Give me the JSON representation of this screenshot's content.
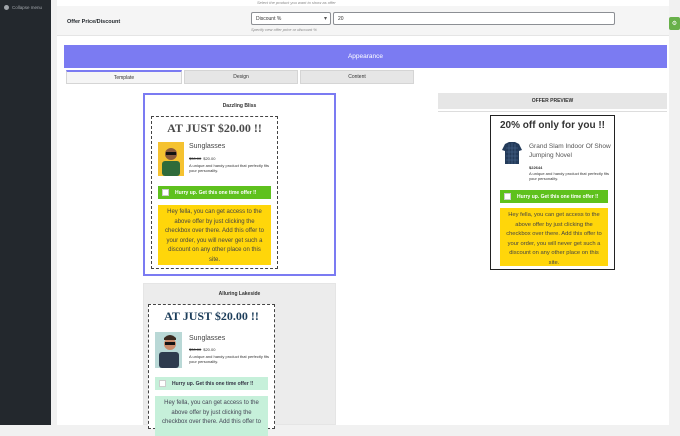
{
  "sidebar": {
    "collapse_label": "Collapse menu"
  },
  "offer_row": {
    "top_hint": "Select the product you want to show as offer",
    "label": "Offer Price/Discount",
    "type_value": "Discount %",
    "amount_value": "20",
    "hint": "Specify new offer price or discount %"
  },
  "appearance": {
    "title": "Appearance"
  },
  "tabs": [
    {
      "label": "Template"
    },
    {
      "label": "Design"
    },
    {
      "label": "Content"
    }
  ],
  "templates": [
    {
      "name": "Dazzling Bliss",
      "headline": "AT JUST $20.00 !!",
      "product": "Sunglasses",
      "old_price": "$30.00",
      "new_price": "$20.00",
      "description": "A unique and handy product that perfectly fits your personality.",
      "cta": "Hurry up. Get this one time offer !!",
      "message": "Hey fella, you can get access to the above offer by just clicking the checkbox over there. Add this offer to your order, you will never get such a discount on any other place on this site."
    },
    {
      "name": "Alluring Lakeside",
      "headline": "AT JUST $20.00 !!",
      "product": "Sunglasses",
      "old_price": "$30.00",
      "new_price": "$20.00",
      "description": "A unique and handy product that perfectly fits your personality.",
      "cta": "Hurry up. Get this one time offer !!",
      "message": "Hey fella, you can get access to the above offer by just clicking the checkbox over there. Add this offer to"
    }
  ],
  "preview": {
    "heading": "OFFER PREVIEW",
    "headline": "20% off only for you !!",
    "product": "Grand Slam Indoor Of Show Jumping Novel",
    "price": "$22644",
    "description": "A unique and handy product that perfectly fits your personality.",
    "cta": "Hurry up. Get this one time offer !!",
    "message": "Hey fella, you can get access to the above offer by just clicking the checkbox over there. Add this offer to your order, you will never get such a discount on any other place on this site."
  },
  "colors": {
    "accent": "#7b7bf2",
    "green": "#5fc11d",
    "yellow": "#ffd60a",
    "mint": "#c6f0da"
  }
}
